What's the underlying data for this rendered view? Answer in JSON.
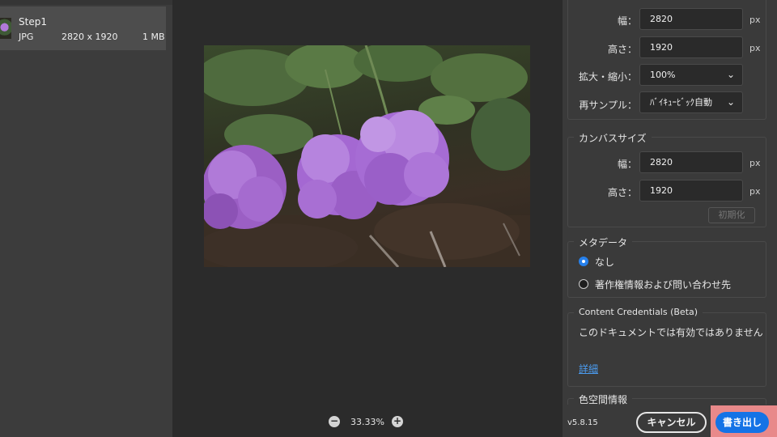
{
  "asset": {
    "name": "Step1",
    "format": "JPG",
    "dimensions": "2820 x 1920",
    "size": "1 MB"
  },
  "zoom": {
    "value": "33.33%",
    "out_icon": "minus-circle-icon",
    "in_icon": "plus-circle-icon"
  },
  "image_size": {
    "width_label": "幅：",
    "width_value": "2820",
    "width_unit": "px",
    "height_label": "高さ：",
    "height_value": "1920",
    "height_unit": "px",
    "scale_label": "拡大・縮小：",
    "scale_value": "100%",
    "resample_label": "再サンプル：",
    "resample_value": "ﾊﾞｲｷｭｰﾋﾞｯｸ自動"
  },
  "canvas_size": {
    "title": "カンバスサイズ",
    "width_label": "幅：",
    "width_value": "2820",
    "width_unit": "px",
    "height_label": "高さ：",
    "height_value": "1920",
    "height_unit": "px",
    "reset_label": "初期化"
  },
  "metadata": {
    "title": "メタデータ",
    "option_none": "なし",
    "option_copyright": "著作権情報および問い合わせ先",
    "selected": "なし"
  },
  "content_credentials": {
    "title": "Content Credentials (Beta)",
    "text": "このドキュメントでは有効ではありません",
    "link": "詳細"
  },
  "color_space": {
    "title": "色空間情報"
  },
  "footer": {
    "version": "v5.8.15",
    "cancel_label": "キャンセル",
    "export_label": "書き出し"
  },
  "colors": {
    "accent": "#1473e6",
    "highlight": "#e8898a",
    "link": "#4b9cf0"
  }
}
